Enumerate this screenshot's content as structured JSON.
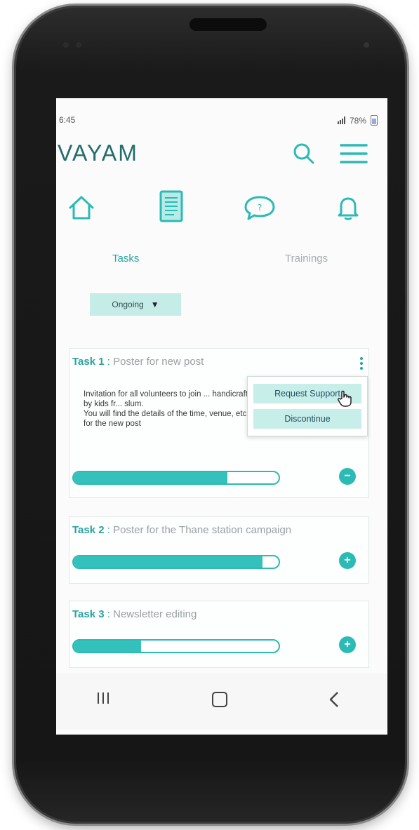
{
  "status_bar": {
    "time": "6:45",
    "battery": "78%"
  },
  "app": {
    "logo": "VAYAM"
  },
  "header_icons": [
    "search-icon",
    "menu-icon"
  ],
  "nav_icons": [
    "home-icon",
    "tasks-document-icon",
    "chat-icon",
    "notification-bell-icon"
  ],
  "tabs": [
    {
      "label": "Tasks",
      "active": true
    },
    {
      "label": "Trainings",
      "active": false
    }
  ],
  "filter": {
    "label": "Ongoing",
    "caret": "▼"
  },
  "tasks": [
    {
      "number": "Task 1",
      "separator": ":",
      "title": "Poster for new post",
      "description": "Invitation for all volunteers to join ... handicraft items made by kids fr... slum.\nYou will find the details of the time, venue, etc. from Anu for the new post",
      "progress": 0.75,
      "action": "−",
      "expanded": true
    },
    {
      "number": "Task 2",
      "separator": ":",
      "title": "Poster for the Thane station campaign",
      "progress": 0.92,
      "action": "+"
    },
    {
      "number": "Task 3",
      "separator": ":",
      "title": "Newsletter editing",
      "progress": 0.33,
      "action": "+"
    }
  ],
  "context_menu": {
    "items": [
      "Request Support",
      "Discontinue"
    ]
  },
  "system_nav": [
    "recent-apps-icon",
    "home-square-icon",
    "back-icon"
  ],
  "colors": {
    "accent": "#2cbab5",
    "logo": "#236c6c",
    "chip": "#c6ece8",
    "active_tab": "#2aa39f"
  }
}
